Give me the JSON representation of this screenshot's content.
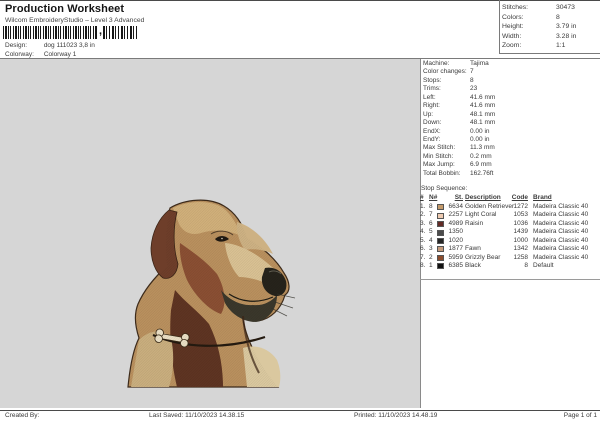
{
  "header": {
    "title": "Production Worksheet",
    "subtitle": "Wilcom EmbroideryStudio – Level 3 Advanced",
    "design_label": "Design:",
    "design_value": "dog 111023 3,8 in",
    "colorway_label": "Colorway:",
    "colorway_value": "Colorway 1",
    "barcode_separator": ","
  },
  "summary": {
    "rows": [
      {
        "label": "Stitches:",
        "value": "30473"
      },
      {
        "label": "Colors:",
        "value": "8"
      },
      {
        "label": "Height:",
        "value": "3.79 in"
      },
      {
        "label": "Width:",
        "value": "3.28 in"
      },
      {
        "label": "Zoom:",
        "value": "1:1"
      }
    ]
  },
  "machine": {
    "rows": [
      {
        "label": "Machine:",
        "value": "Tajima"
      },
      {
        "label": "Color changes:",
        "value": "7"
      },
      {
        "label": "Stops:",
        "value": "8"
      },
      {
        "label": "Trims:",
        "value": "23"
      },
      {
        "label": "Left:",
        "value": "41.6 mm"
      },
      {
        "label": "Right:",
        "value": "41.6 mm"
      },
      {
        "label": "Up:",
        "value": "48.1 mm"
      },
      {
        "label": "Down:",
        "value": "48.1 mm"
      },
      {
        "label": "EndX:",
        "value": "0.00 in"
      },
      {
        "label": "EndY:",
        "value": "0.00 in"
      },
      {
        "label": "Max Stitch:",
        "value": "11.3 mm"
      },
      {
        "label": "Min Stitch:",
        "value": "0.2 mm"
      },
      {
        "label": "Max Jump:",
        "value": "6.9 mm"
      },
      {
        "label": "Total Bobbin:",
        "value": "162.76ft"
      }
    ]
  },
  "stop_sequence": {
    "title": "Stop Sequence:",
    "headers": {
      "num": "#",
      "needle": "N#",
      "st": "St.",
      "description": "Description",
      "code": "Code",
      "brand": "Brand"
    },
    "rows": [
      {
        "num": "1.",
        "needle": "8",
        "color": "#C49A6A",
        "st": "6634",
        "description": "Golden Retriever",
        "code": "1272",
        "brand": "Madeira Classic 40"
      },
      {
        "num": "2.",
        "needle": "7",
        "color": "#EECBB2",
        "st": "2257",
        "description": "Light Coral",
        "code": "1053",
        "brand": "Madeira Classic 40"
      },
      {
        "num": "3.",
        "needle": "6",
        "color": "#632B26",
        "st": "4989",
        "description": "Raisin",
        "code": "1036",
        "brand": "Madeira Classic 40"
      },
      {
        "num": "4.",
        "needle": "5",
        "color": "#4C4C4C",
        "st": "1350",
        "description": "",
        "code": "1439",
        "brand": "Madeira Classic 40"
      },
      {
        "num": "5.",
        "needle": "4",
        "color": "#262626",
        "st": "1020",
        "description": "",
        "code": "1000",
        "brand": "Madeira Classic 40"
      },
      {
        "num": "6.",
        "needle": "3",
        "color": "#C59B7C",
        "st": "1877",
        "description": "Fawn",
        "code": "1342",
        "brand": "Madeira Classic 40"
      },
      {
        "num": "7.",
        "needle": "2",
        "color": "#8C4C2C",
        "st": "5959",
        "description": "Grizzly Bear",
        "code": "1258",
        "brand": "Madeira Classic 40"
      },
      {
        "num": "8.",
        "needle": "1",
        "color": "#121212",
        "st": "6385",
        "description": "Black",
        "code": "8",
        "brand": "Default"
      }
    ]
  },
  "footer": {
    "created_by": "Created By:",
    "last_saved": "Last Saved: 11/10/2023 14.38.15",
    "printed": "Printed: 11/10/2023 14.48.19",
    "page": "Page 1 of 1"
  }
}
